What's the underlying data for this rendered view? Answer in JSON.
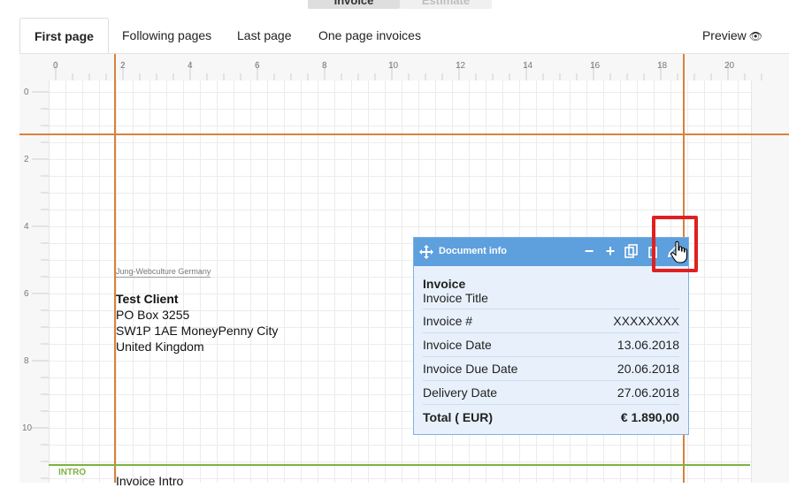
{
  "top_toggle": {
    "invoice": "Invoice",
    "estimate": "Estimate"
  },
  "tabs": [
    {
      "label": "First page",
      "active": true
    },
    {
      "label": "Following pages"
    },
    {
      "label": "Last page"
    },
    {
      "label": "One page invoices"
    }
  ],
  "preview": {
    "label": "Preview",
    "icon": "eye-icon"
  },
  "ruler": {
    "horizontal": [
      "0",
      "2",
      "4",
      "6",
      "8",
      "10",
      "12",
      "14",
      "16",
      "18",
      "20"
    ],
    "vertical": [
      "0",
      "2",
      "4",
      "6",
      "8",
      "10"
    ]
  },
  "sender_line": "Jung-Webculture Germany",
  "client": {
    "name": "Test Client",
    "line1": "PO Box 3255",
    "line2": "SW1P 1AE MoneyPenny City",
    "line3": "United Kingdom"
  },
  "intro": {
    "label": "INTRO",
    "text": "Invoice Intro"
  },
  "document_info": {
    "title": "Document info",
    "heading": "Invoice",
    "subtitle": "Invoice Title",
    "rows": [
      {
        "label": "Invoice #",
        "value": "XXXXXXXX"
      },
      {
        "label": "Invoice Date",
        "value": "13.06.2018"
      },
      {
        "label": "Invoice Due Date",
        "value": "20.06.2018"
      },
      {
        "label": "Delivery Date",
        "value": "27.06.2018"
      }
    ],
    "total": {
      "label": "Total ( EUR)",
      "value": "€ 1.890,00"
    }
  },
  "colors": {
    "guide": "#d9823b",
    "intro": "#7cb342",
    "box_header": "#5e9fdd",
    "highlight": "#e02020"
  }
}
